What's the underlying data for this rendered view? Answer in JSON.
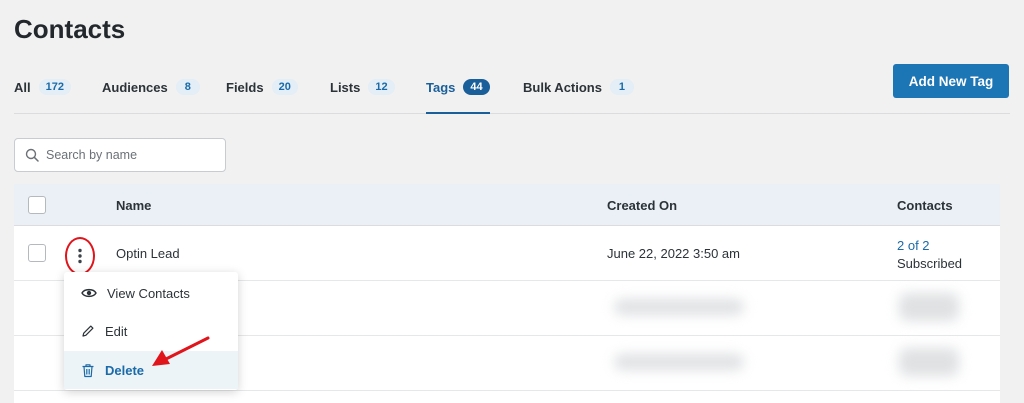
{
  "page": {
    "title": "Contacts"
  },
  "tabs": [
    {
      "label": "All",
      "count": "172"
    },
    {
      "label": "Audiences",
      "count": "8"
    },
    {
      "label": "Fields",
      "count": "20"
    },
    {
      "label": "Lists",
      "count": "12"
    },
    {
      "label": "Tags",
      "count": "44",
      "active": true
    },
    {
      "label": "Bulk Actions",
      "count": "1"
    }
  ],
  "toolbar": {
    "add_label": "Add New Tag"
  },
  "search": {
    "placeholder": "Search by name"
  },
  "table": {
    "columns": [
      "Name",
      "Created On",
      "Contacts"
    ],
    "rows": [
      {
        "name": "Optin Lead",
        "created_on": "June 22, 2022 3:50 am",
        "contacts_link": "2 of 2",
        "contacts_status": "Subscribed"
      }
    ]
  },
  "row_menu": {
    "items": [
      {
        "label": "View Contacts",
        "icon": "eye-icon"
      },
      {
        "label": "Edit",
        "icon": "pencil-icon"
      },
      {
        "label": "Delete",
        "icon": "trash-icon"
      }
    ]
  },
  "colors": {
    "accent": "#1c75b4",
    "active_tab": "#1a5f9a",
    "highlight_annotation": "#e0141b"
  }
}
